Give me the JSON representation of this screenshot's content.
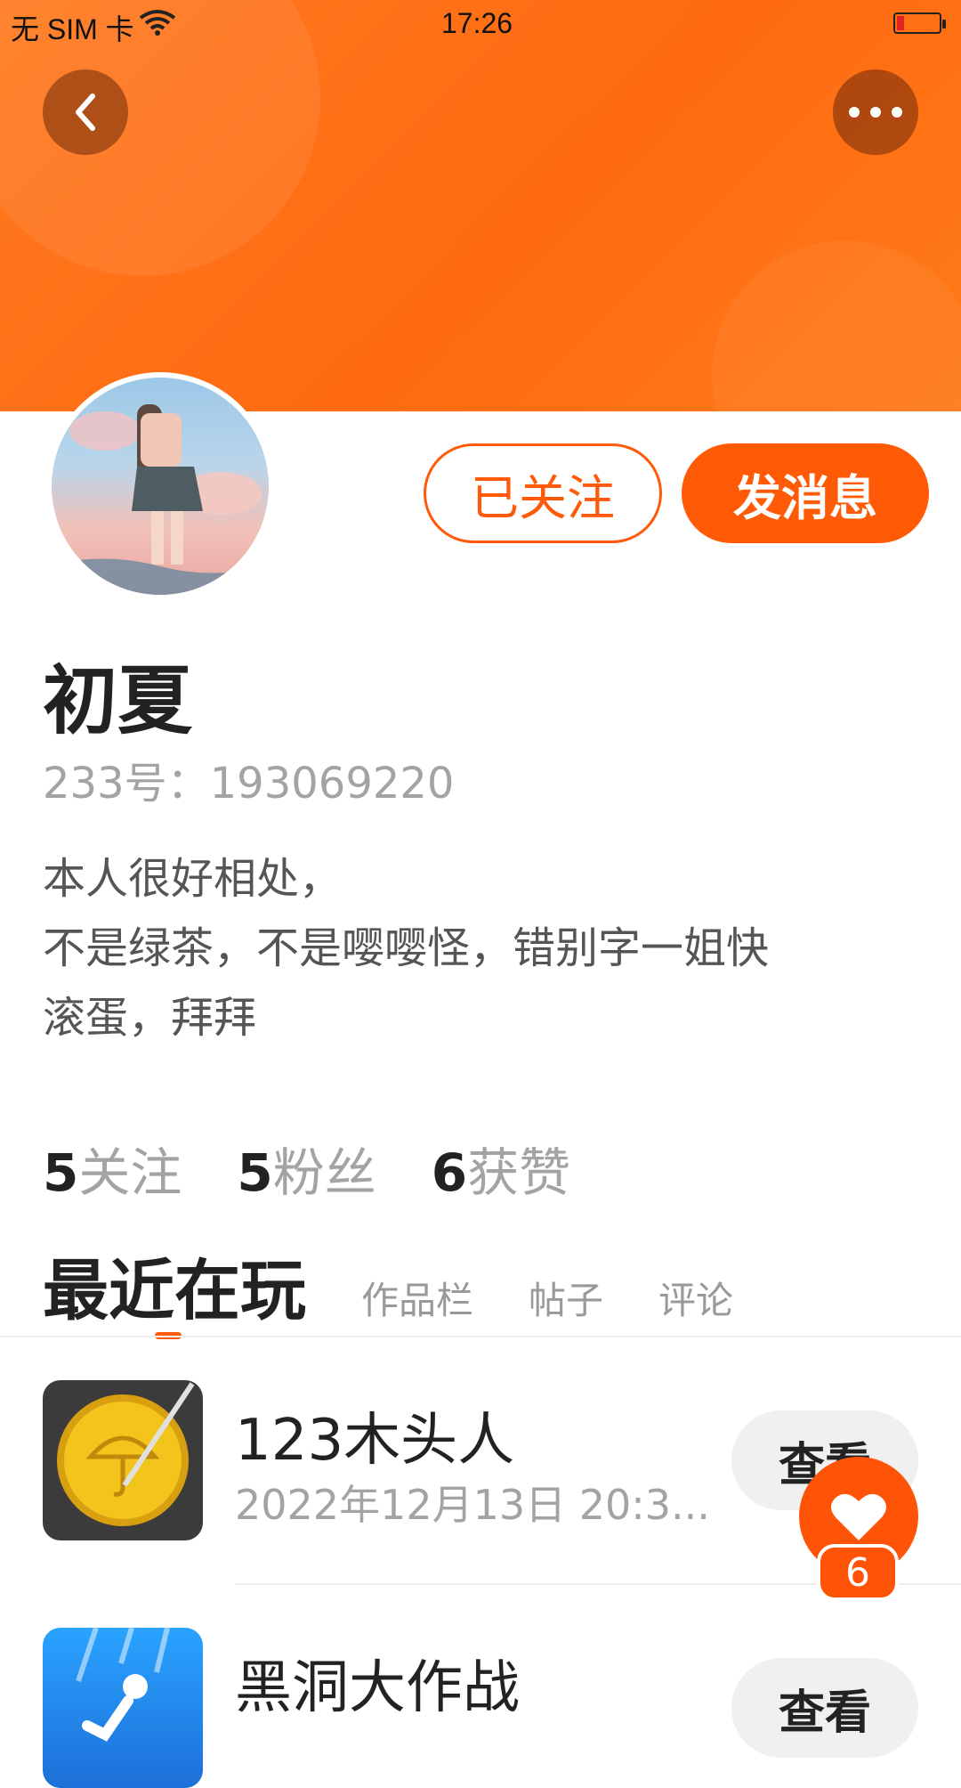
{
  "status_bar": {
    "carrier": "无 SIM 卡",
    "time": "17:26"
  },
  "header": {
    "back_icon": "chevron-left-icon",
    "more_icon": "more-horizontal-icon"
  },
  "profile": {
    "name": "初夏",
    "uid_text": "233号：193069220",
    "bio_lines": [
      "本人很好相处，",
      "不是绿茶，不是嘤嘤怪，错别字一姐快",
      "滚蛋，拜拜"
    ],
    "follow_button": "已关注",
    "message_button": "发消息"
  },
  "stats": [
    {
      "num": "5",
      "label": "关注"
    },
    {
      "num": "5",
      "label": "粉丝"
    },
    {
      "num": "6",
      "label": "获赞"
    }
  ],
  "tabs": {
    "active": "最近在玩",
    "others": [
      "作品栏",
      "帖子",
      "评论"
    ]
  },
  "games": [
    {
      "title": "123木头人",
      "date": "2022年12月13日 20:3...",
      "button": "查看"
    },
    {
      "title": "黑洞大作战",
      "date": "",
      "button": "查看"
    }
  ],
  "like_fab": {
    "count": "6"
  },
  "colors": {
    "accent": "#ff5a05",
    "banner": "#ff7a1f"
  }
}
